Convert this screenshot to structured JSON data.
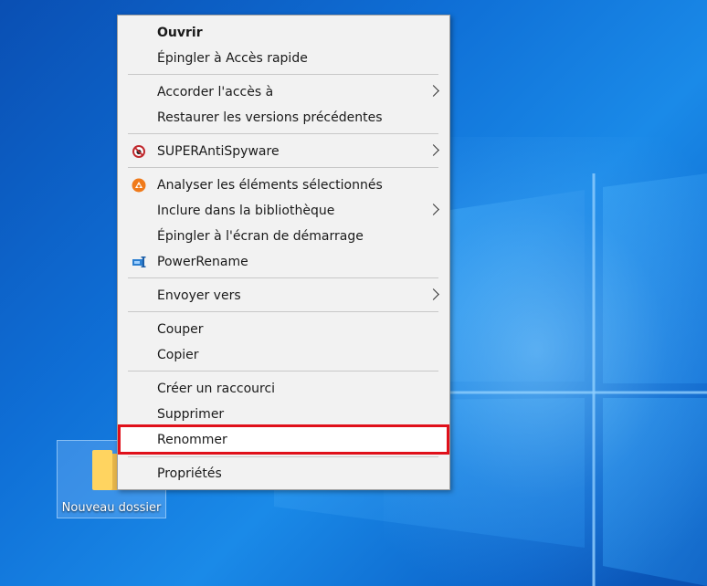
{
  "menu": {
    "items": [
      {
        "label": "Ouvrir"
      },
      {
        "label": "Épingler à Accès rapide"
      },
      {
        "label": "Accorder l'accès à"
      },
      {
        "label": "Restaurer les versions précédentes"
      },
      {
        "label": "SUPERAntiSpyware"
      },
      {
        "label": "Analyser les éléments sélectionnés"
      },
      {
        "label": "Inclure dans la bibliothèque"
      },
      {
        "label": "Épingler à l'écran de démarrage"
      },
      {
        "label": "PowerRename"
      },
      {
        "label": "Envoyer vers"
      },
      {
        "label": "Couper"
      },
      {
        "label": "Copier"
      },
      {
        "label": "Créer un raccourci"
      },
      {
        "label": "Supprimer"
      },
      {
        "label": "Renommer"
      },
      {
        "label": "Propriétés"
      }
    ]
  },
  "desktop": {
    "folder_label": "Nouveau dossier"
  },
  "colors": {
    "highlight_border": "#e0101a",
    "menu_bg": "#f2f2f2"
  }
}
